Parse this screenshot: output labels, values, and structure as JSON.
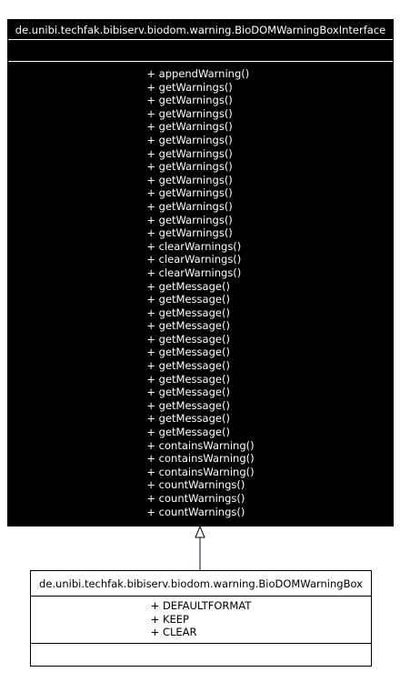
{
  "interface_class": {
    "name": "de.unibi.techfak.bibiserv.biodom.warning.BioDOMWarningBoxInterface",
    "attributes": [],
    "operations": [
      "+ appendWarning()",
      "+ getWarnings()",
      "+ getWarnings()",
      "+ getWarnings()",
      "+ getWarnings()",
      "+ getWarnings()",
      "+ getWarnings()",
      "+ getWarnings()",
      "+ getWarnings()",
      "+ getWarnings()",
      "+ getWarnings()",
      "+ getWarnings()",
      "+ getWarnings()",
      "+ clearWarnings()",
      "+ clearWarnings()",
      "+ clearWarnings()",
      "+ getMessage()",
      "+ getMessage()",
      "+ getMessage()",
      "+ getMessage()",
      "+ getMessage()",
      "+ getMessage()",
      "+ getMessage()",
      "+ getMessage()",
      "+ getMessage()",
      "+ getMessage()",
      "+ getMessage()",
      "+ getMessage()",
      "+ containsWarning()",
      "+ containsWarning()",
      "+ containsWarning()",
      "+ countWarnings()",
      "+ countWarnings()",
      "+ countWarnings()"
    ]
  },
  "implementation_class": {
    "name": "de.unibi.techfak.bibiserv.biodom.warning.BioDOMWarningBox",
    "attributes": [
      "+ DEFAULTFORMAT",
      "+ KEEP",
      "+ CLEAR"
    ],
    "operations": []
  },
  "relationship": {
    "type": "realization",
    "from": "implementation_class",
    "to": "interface_class",
    "line_color": "#000080"
  },
  "colors": {
    "interface_fill": "#000000",
    "interface_text": "#ffffff",
    "impl_fill": "#ffffff",
    "impl_text": "#000000"
  }
}
